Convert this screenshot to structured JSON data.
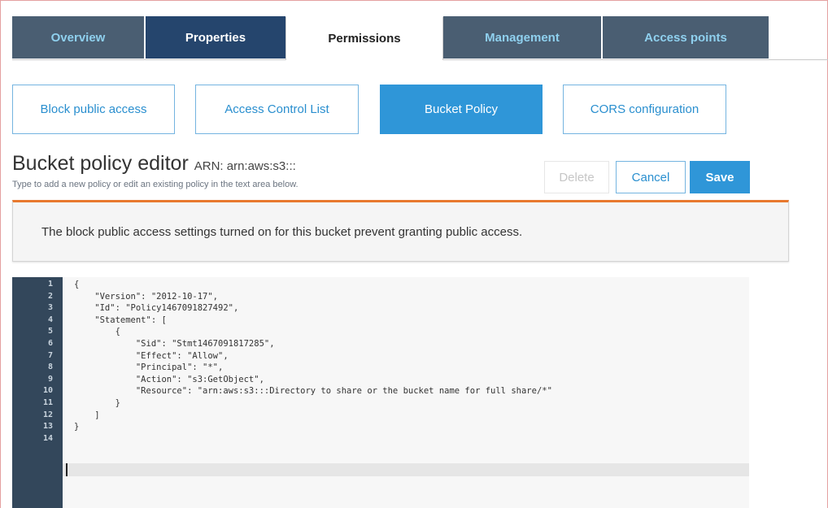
{
  "tabs": [
    {
      "label": "Overview"
    },
    {
      "label": "Properties"
    },
    {
      "label": "Permissions"
    },
    {
      "label": "Management"
    },
    {
      "label": "Access points"
    }
  ],
  "subtabs": [
    {
      "label": "Block public access"
    },
    {
      "label": "Access Control List"
    },
    {
      "label": "Bucket Policy"
    },
    {
      "label": "CORS configuration"
    }
  ],
  "editor": {
    "title": "Bucket policy editor",
    "arn_label": "ARN: arn:aws:s3:::",
    "hint": "Type to add a new policy or edit an existing policy in the text area below.",
    "delete_label": "Delete",
    "cancel_label": "Cancel",
    "save_label": "Save"
  },
  "alert": {
    "message": "The block public access settings turned on for this bucket prevent granting public access."
  },
  "code": {
    "line_numbers": [
      "1",
      "2",
      "3",
      "4",
      "5",
      "6",
      "7",
      "8",
      "9",
      "10",
      "11",
      "12",
      "13",
      "14"
    ],
    "lines": [
      "{",
      "    \"Version\": \"2012-10-17\",",
      "    \"Id\": \"Policy1467091827492\",",
      "    \"Statement\": [",
      "        {",
      "            \"Sid\": \"Stmt1467091817285\",",
      "            \"Effect\": \"Allow\",",
      "            \"Principal\": \"*\",",
      "            \"Action\": \"s3:GetObject\",",
      "            \"Resource\": \"arn:aws:s3:::Directory to share or the bucket name for full share/*\"",
      "        }",
      "    ]",
      "}",
      ""
    ]
  },
  "colors": {
    "tab_dim": "#4a5e72",
    "tab_navy": "#25456d",
    "accent_blue": "#2f96d8",
    "alert_orange": "#e8792e",
    "gutter": "#33475b"
  }
}
